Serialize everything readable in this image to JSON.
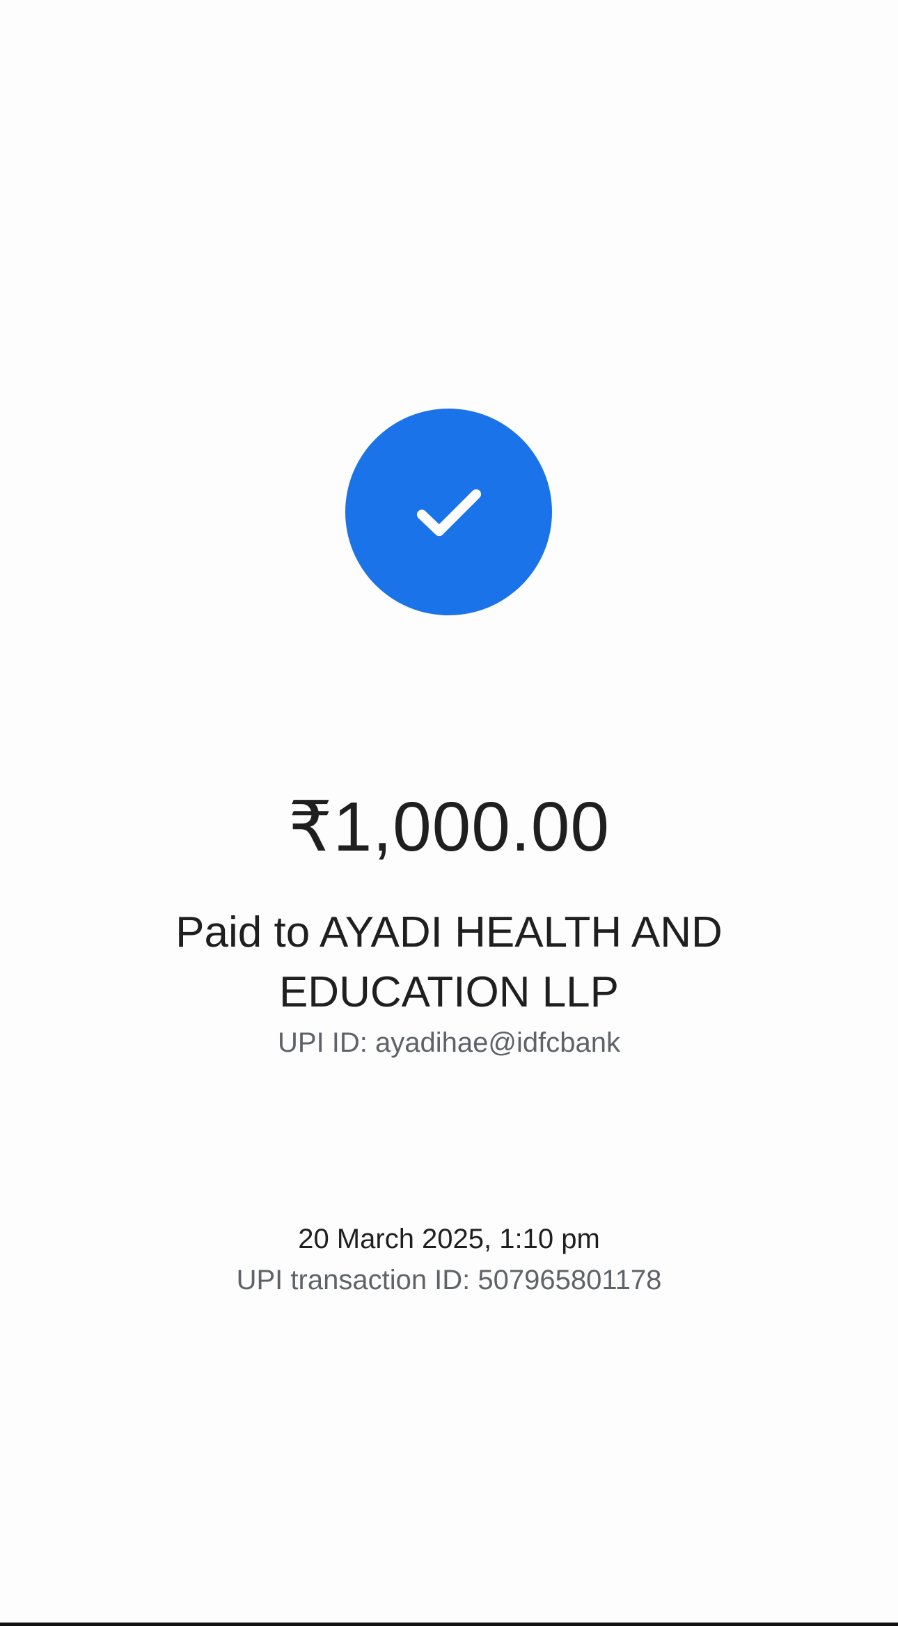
{
  "status": {
    "icon": "check-circle-icon",
    "color": "#1a73e8"
  },
  "payment": {
    "amount": "₹1,000.00",
    "payee_line": "Paid to AYADI HEALTH AND EDUCATION LLP",
    "upi_id": "UPI ID: ayadihae@idfcbank"
  },
  "transaction": {
    "datetime": "20 March 2025, 1:10 pm",
    "upi_transaction_id": "UPI transaction ID: 507965801178"
  }
}
